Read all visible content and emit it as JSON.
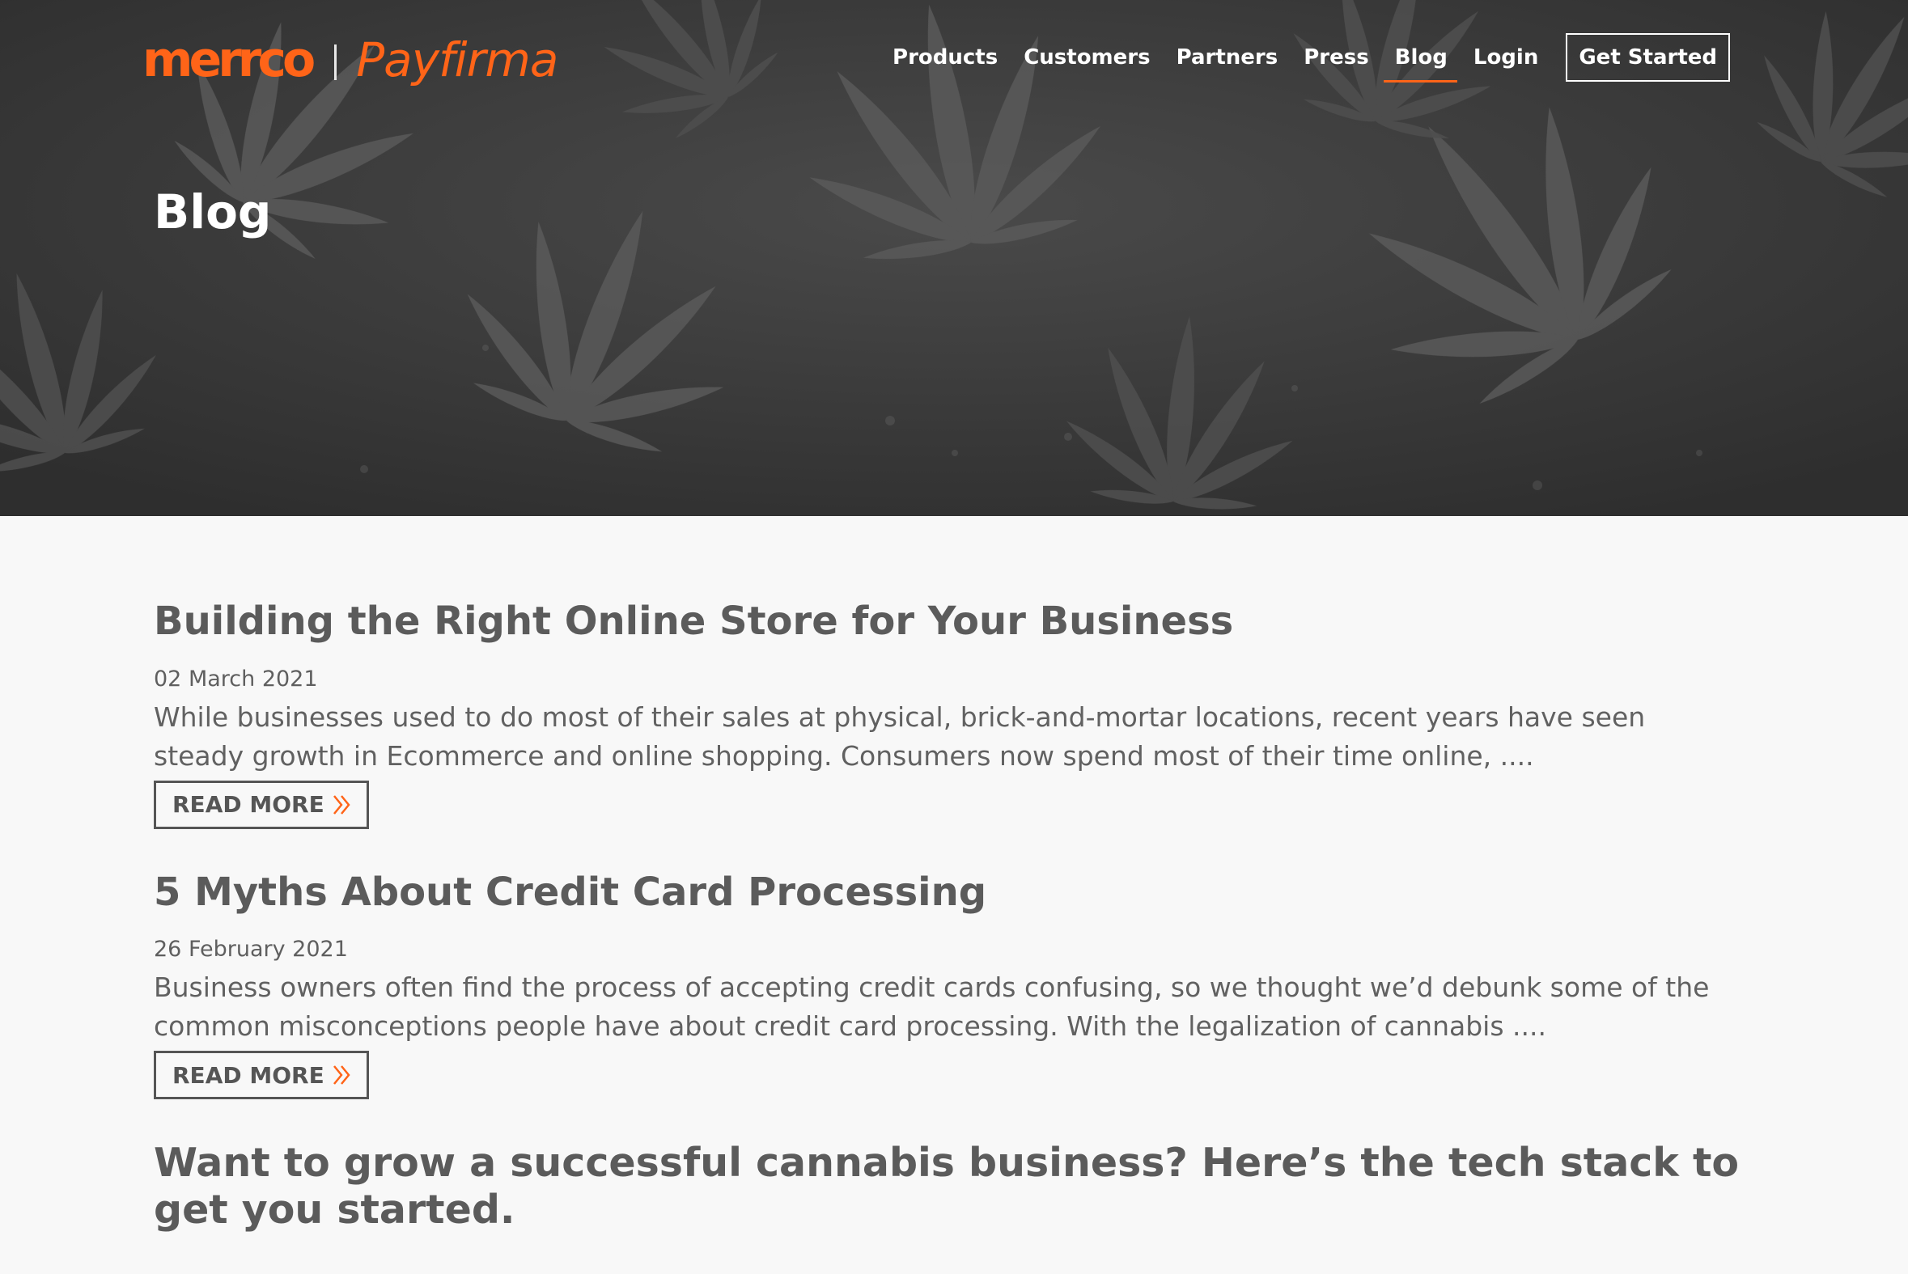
{
  "brand": {
    "primary": "merrco",
    "secondary": "Payfirma",
    "accent_color": "#ff6418"
  },
  "nav": {
    "items": [
      {
        "label": "Products"
      },
      {
        "label": "Customers"
      },
      {
        "label": "Partners"
      },
      {
        "label": "Press"
      },
      {
        "label": "Blog",
        "active": true
      },
      {
        "label": "Login"
      }
    ],
    "cta_label": "Get Started"
  },
  "hero": {
    "title": "Blog",
    "background_icon": "cannabis-leaf-icon"
  },
  "posts": [
    {
      "title": "Building the Right Online Store for Your Business",
      "date": "02 March 2021",
      "excerpt": "While businesses used to do most of their sales at physical, brick-and-mortar locations, recent years have seen steady growth in Ecommerce and online shopping. Consumers now spend most of their time online, ....",
      "read_more": "READ MORE"
    },
    {
      "title": "5 Myths About Credit Card Processing",
      "date": "26 February 2021",
      "excerpt": "Business owners often find the process of accepting credit cards confusing, so we thought we’d debunk some of the common misconceptions people have about credit card processing. With the legalization of cannabis ....",
      "read_more": "READ MORE"
    },
    {
      "title": "Want to grow a successful cannabis business? Here’s the tech stack to get you started."
    }
  ]
}
